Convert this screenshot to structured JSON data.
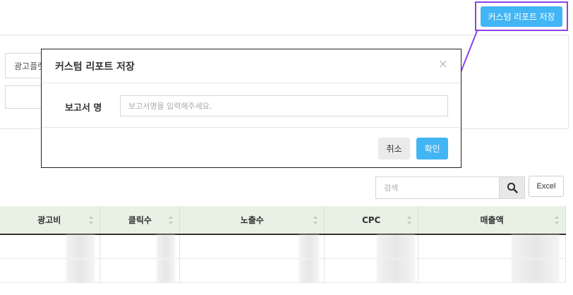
{
  "header": {
    "save_report_button": "커스텀 리포트 저장"
  },
  "filters": {
    "platform_select": "광고플랫폼"
  },
  "modal": {
    "title": "커스텀 리포트 저장",
    "close_glyph": "×",
    "field_label": "보고서 명",
    "input_placeholder": "보고서명을 입력해주세요.",
    "cancel_label": "취소",
    "confirm_label": "확인"
  },
  "toolbar": {
    "search_placeholder": "검색",
    "search_icon": "search-icon",
    "excel_label": "Excel"
  },
  "table": {
    "columns": [
      "광고비",
      "클릭수",
      "노출수",
      "CPC",
      "매출액"
    ]
  },
  "colors": {
    "primary_button": "#42b5f5",
    "highlight": "#8a44e6",
    "table_header_bg": "#e9f1e5"
  }
}
